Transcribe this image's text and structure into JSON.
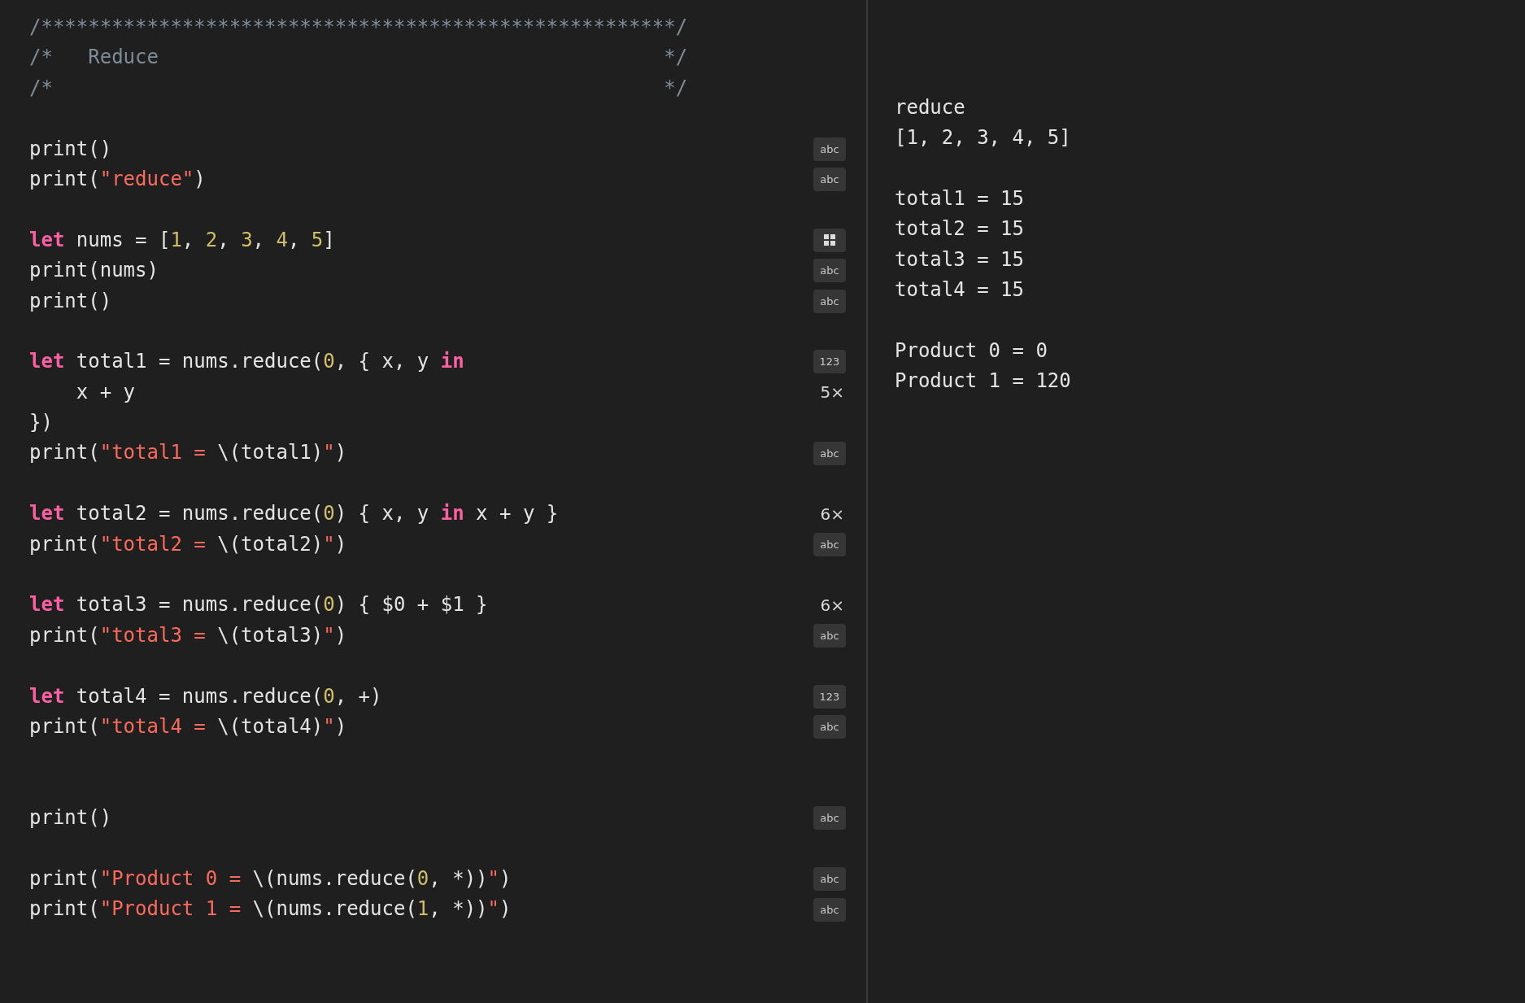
{
  "editor": {
    "lines": [
      {
        "kind": "code",
        "tokens": [
          {
            "kind": "comment",
            "text": "/******************************************************/"
          }
        ]
      },
      {
        "kind": "code",
        "tokens": [
          {
            "kind": "comment",
            "text": "/*   Reduce                                           */"
          }
        ]
      },
      {
        "kind": "code",
        "tokens": [
          {
            "kind": "comment",
            "text": "/*                                                    */"
          }
        ]
      },
      {
        "kind": "blank"
      },
      {
        "kind": "code",
        "tokens": [
          {
            "kind": "plain",
            "text": "print()"
          }
        ],
        "result": {
          "kind": "badge",
          "text": "abc"
        }
      },
      {
        "kind": "code",
        "tokens": [
          {
            "kind": "plain",
            "text": "print("
          },
          {
            "kind": "string",
            "text": "\"reduce\""
          },
          {
            "kind": "plain",
            "text": ")"
          }
        ],
        "result": {
          "kind": "badge",
          "text": "abc"
        }
      },
      {
        "kind": "blank"
      },
      {
        "kind": "code",
        "tokens": [
          {
            "kind": "keyword",
            "text": "let"
          },
          {
            "kind": "plain",
            "text": " nums = ["
          },
          {
            "kind": "number",
            "text": "1"
          },
          {
            "kind": "plain",
            "text": ", "
          },
          {
            "kind": "number",
            "text": "2"
          },
          {
            "kind": "plain",
            "text": ", "
          },
          {
            "kind": "number",
            "text": "3"
          },
          {
            "kind": "plain",
            "text": ", "
          },
          {
            "kind": "number",
            "text": "4"
          },
          {
            "kind": "plain",
            "text": ", "
          },
          {
            "kind": "number",
            "text": "5"
          },
          {
            "kind": "plain",
            "text": "]"
          }
        ],
        "result": {
          "kind": "grid"
        }
      },
      {
        "kind": "code",
        "tokens": [
          {
            "kind": "plain",
            "text": "print(nums)"
          }
        ],
        "result": {
          "kind": "badge",
          "text": "abc"
        }
      },
      {
        "kind": "code",
        "tokens": [
          {
            "kind": "plain",
            "text": "print()"
          }
        ],
        "result": {
          "kind": "badge",
          "text": "abc"
        }
      },
      {
        "kind": "blank"
      },
      {
        "kind": "code",
        "tokens": [
          {
            "kind": "keyword",
            "text": "let"
          },
          {
            "kind": "plain",
            "text": " total1 = nums.reduce("
          },
          {
            "kind": "number",
            "text": "0"
          },
          {
            "kind": "plain",
            "text": ", { x, y "
          },
          {
            "kind": "keyword",
            "text": "in"
          }
        ],
        "result": {
          "kind": "badge",
          "text": "123"
        }
      },
      {
        "kind": "code",
        "tokens": [
          {
            "kind": "plain",
            "text": "    x + y"
          }
        ],
        "result": {
          "kind": "count",
          "text": "5×"
        }
      },
      {
        "kind": "code",
        "tokens": [
          {
            "kind": "plain",
            "text": "})"
          }
        ]
      },
      {
        "kind": "code",
        "tokens": [
          {
            "kind": "plain",
            "text": "print("
          },
          {
            "kind": "string",
            "text": "\"total1 = "
          },
          {
            "kind": "plain",
            "text": "\\(total1)"
          },
          {
            "kind": "string",
            "text": "\""
          },
          {
            "kind": "plain",
            "text": ")"
          }
        ],
        "result": {
          "kind": "badge",
          "text": "abc"
        }
      },
      {
        "kind": "blank"
      },
      {
        "kind": "code",
        "tokens": [
          {
            "kind": "keyword",
            "text": "let"
          },
          {
            "kind": "plain",
            "text": " total2 = nums.reduce("
          },
          {
            "kind": "number",
            "text": "0"
          },
          {
            "kind": "plain",
            "text": ") { x, y "
          },
          {
            "kind": "keyword",
            "text": "in"
          },
          {
            "kind": "plain",
            "text": " x + y }"
          }
        ],
        "result": {
          "kind": "count",
          "text": "6×"
        }
      },
      {
        "kind": "code",
        "tokens": [
          {
            "kind": "plain",
            "text": "print("
          },
          {
            "kind": "string",
            "text": "\"total2 = "
          },
          {
            "kind": "plain",
            "text": "\\(total2)"
          },
          {
            "kind": "string",
            "text": "\""
          },
          {
            "kind": "plain",
            "text": ")"
          }
        ],
        "result": {
          "kind": "badge",
          "text": "abc"
        }
      },
      {
        "kind": "blank"
      },
      {
        "kind": "code",
        "tokens": [
          {
            "kind": "keyword",
            "text": "let"
          },
          {
            "kind": "plain",
            "text": " total3 = nums.reduce("
          },
          {
            "kind": "number",
            "text": "0"
          },
          {
            "kind": "plain",
            "text": ") { $0 + $1 }"
          }
        ],
        "result": {
          "kind": "count",
          "text": "6×"
        }
      },
      {
        "kind": "code",
        "tokens": [
          {
            "kind": "plain",
            "text": "print("
          },
          {
            "kind": "string",
            "text": "\"total3 = "
          },
          {
            "kind": "plain",
            "text": "\\(total3)"
          },
          {
            "kind": "string",
            "text": "\""
          },
          {
            "kind": "plain",
            "text": ")"
          }
        ],
        "result": {
          "kind": "badge",
          "text": "abc"
        }
      },
      {
        "kind": "blank"
      },
      {
        "kind": "code",
        "tokens": [
          {
            "kind": "keyword",
            "text": "let"
          },
          {
            "kind": "plain",
            "text": " total4 = nums.reduce("
          },
          {
            "kind": "number",
            "text": "0"
          },
          {
            "kind": "plain",
            "text": ", +)"
          }
        ],
        "result": {
          "kind": "badge",
          "text": "123"
        }
      },
      {
        "kind": "code",
        "tokens": [
          {
            "kind": "plain",
            "text": "print("
          },
          {
            "kind": "string",
            "text": "\"total4 = "
          },
          {
            "kind": "plain",
            "text": "\\(total4)"
          },
          {
            "kind": "string",
            "text": "\""
          },
          {
            "kind": "plain",
            "text": ")"
          }
        ],
        "result": {
          "kind": "badge",
          "text": "abc"
        }
      },
      {
        "kind": "blank"
      },
      {
        "kind": "blank"
      },
      {
        "kind": "code",
        "tokens": [
          {
            "kind": "plain",
            "text": "print()"
          }
        ],
        "result": {
          "kind": "badge",
          "text": "abc"
        }
      },
      {
        "kind": "blank"
      },
      {
        "kind": "code",
        "tokens": [
          {
            "kind": "plain",
            "text": "print("
          },
          {
            "kind": "string",
            "text": "\"Product 0 = "
          },
          {
            "kind": "plain",
            "text": "\\(nums.reduce("
          },
          {
            "kind": "number",
            "text": "0"
          },
          {
            "kind": "plain",
            "text": ", *))"
          },
          {
            "kind": "string",
            "text": "\""
          },
          {
            "kind": "plain",
            "text": ")"
          }
        ],
        "result": {
          "kind": "badge",
          "text": "abc"
        }
      },
      {
        "kind": "code",
        "tokens": [
          {
            "kind": "plain",
            "text": "print("
          },
          {
            "kind": "string",
            "text": "\"Product 1 = "
          },
          {
            "kind": "plain",
            "text": "\\(nums.reduce("
          },
          {
            "kind": "number",
            "text": "1"
          },
          {
            "kind": "plain",
            "text": ", *))"
          },
          {
            "kind": "string",
            "text": "\""
          },
          {
            "kind": "plain",
            "text": ")"
          }
        ],
        "result": {
          "kind": "badge",
          "text": "abc"
        }
      }
    ]
  },
  "console": {
    "lines": [
      {
        "kind": "text",
        "text": "reduce"
      },
      {
        "kind": "text",
        "text": "[1, 2, 3, 4, 5]"
      },
      {
        "kind": "blank"
      },
      {
        "kind": "text",
        "text": "total1 = 15"
      },
      {
        "kind": "text",
        "text": "total2 = 15"
      },
      {
        "kind": "text",
        "text": "total3 = 15"
      },
      {
        "kind": "text",
        "text": "total4 = 15"
      },
      {
        "kind": "blank"
      },
      {
        "kind": "text",
        "text": "Product 0 = 0"
      },
      {
        "kind": "text",
        "text": "Product 1 = 120"
      }
    ]
  }
}
